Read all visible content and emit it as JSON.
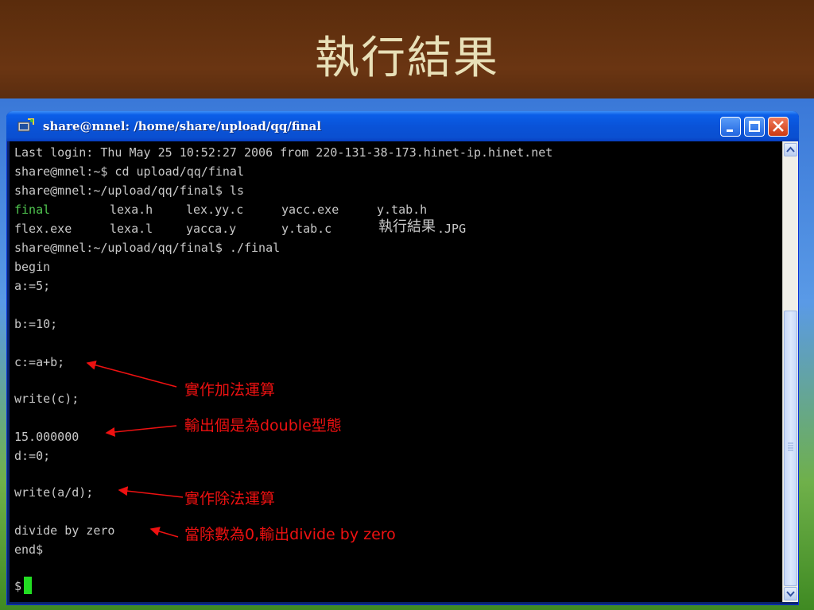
{
  "slide": {
    "title": "執行結果"
  },
  "window": {
    "title": "share@mnel: /home/share/upload/qq/final",
    "minimize_icon": "minimize-icon",
    "maximize_icon": "maximize-icon",
    "close_icon": "close-icon"
  },
  "terminal": {
    "lines": [
      "Last login: Thu May 25 10:52:27 2006 from 220-131-38-173.hinet-ip.hinet.net",
      "share@mnel:~$ cd upload/qq/final",
      "share@mnel:~/upload/qq/final$ ls",
      "",
      "",
      "share@mnel:~/upload/qq/final$ ./final",
      "begin",
      "a:=5;",
      "b:=10;",
      "c:=a+b;",
      "write(c);",
      "15.000000",
      "d:=0;",
      "write(a/d);",
      "divide by zero",
      "end$",
      "$"
    ],
    "ls_row1": [
      "final",
      "lexa.h",
      "lex.yy.c",
      "yacc.exe",
      "y.tab.h"
    ],
    "ls_row2": [
      "flex.exe",
      "lexa.l",
      "yacca.y",
      "y.tab.c",
      "執行結果",
      ".JPG"
    ],
    "ls_colors": {
      "executable": "#50c850",
      "default": "#c8c8c8"
    }
  },
  "annotations": [
    {
      "label": "實作加法運算"
    },
    {
      "label": "輸出個是為double型態"
    },
    {
      "label": "實作除法運算"
    },
    {
      "label": "當除數為0,輸出divide by zero"
    }
  ],
  "colors": {
    "annotation": "#ee1111",
    "cursor": "#22dd22",
    "slide_bg": "#5b2d0f",
    "title": "#e8e0b8"
  }
}
